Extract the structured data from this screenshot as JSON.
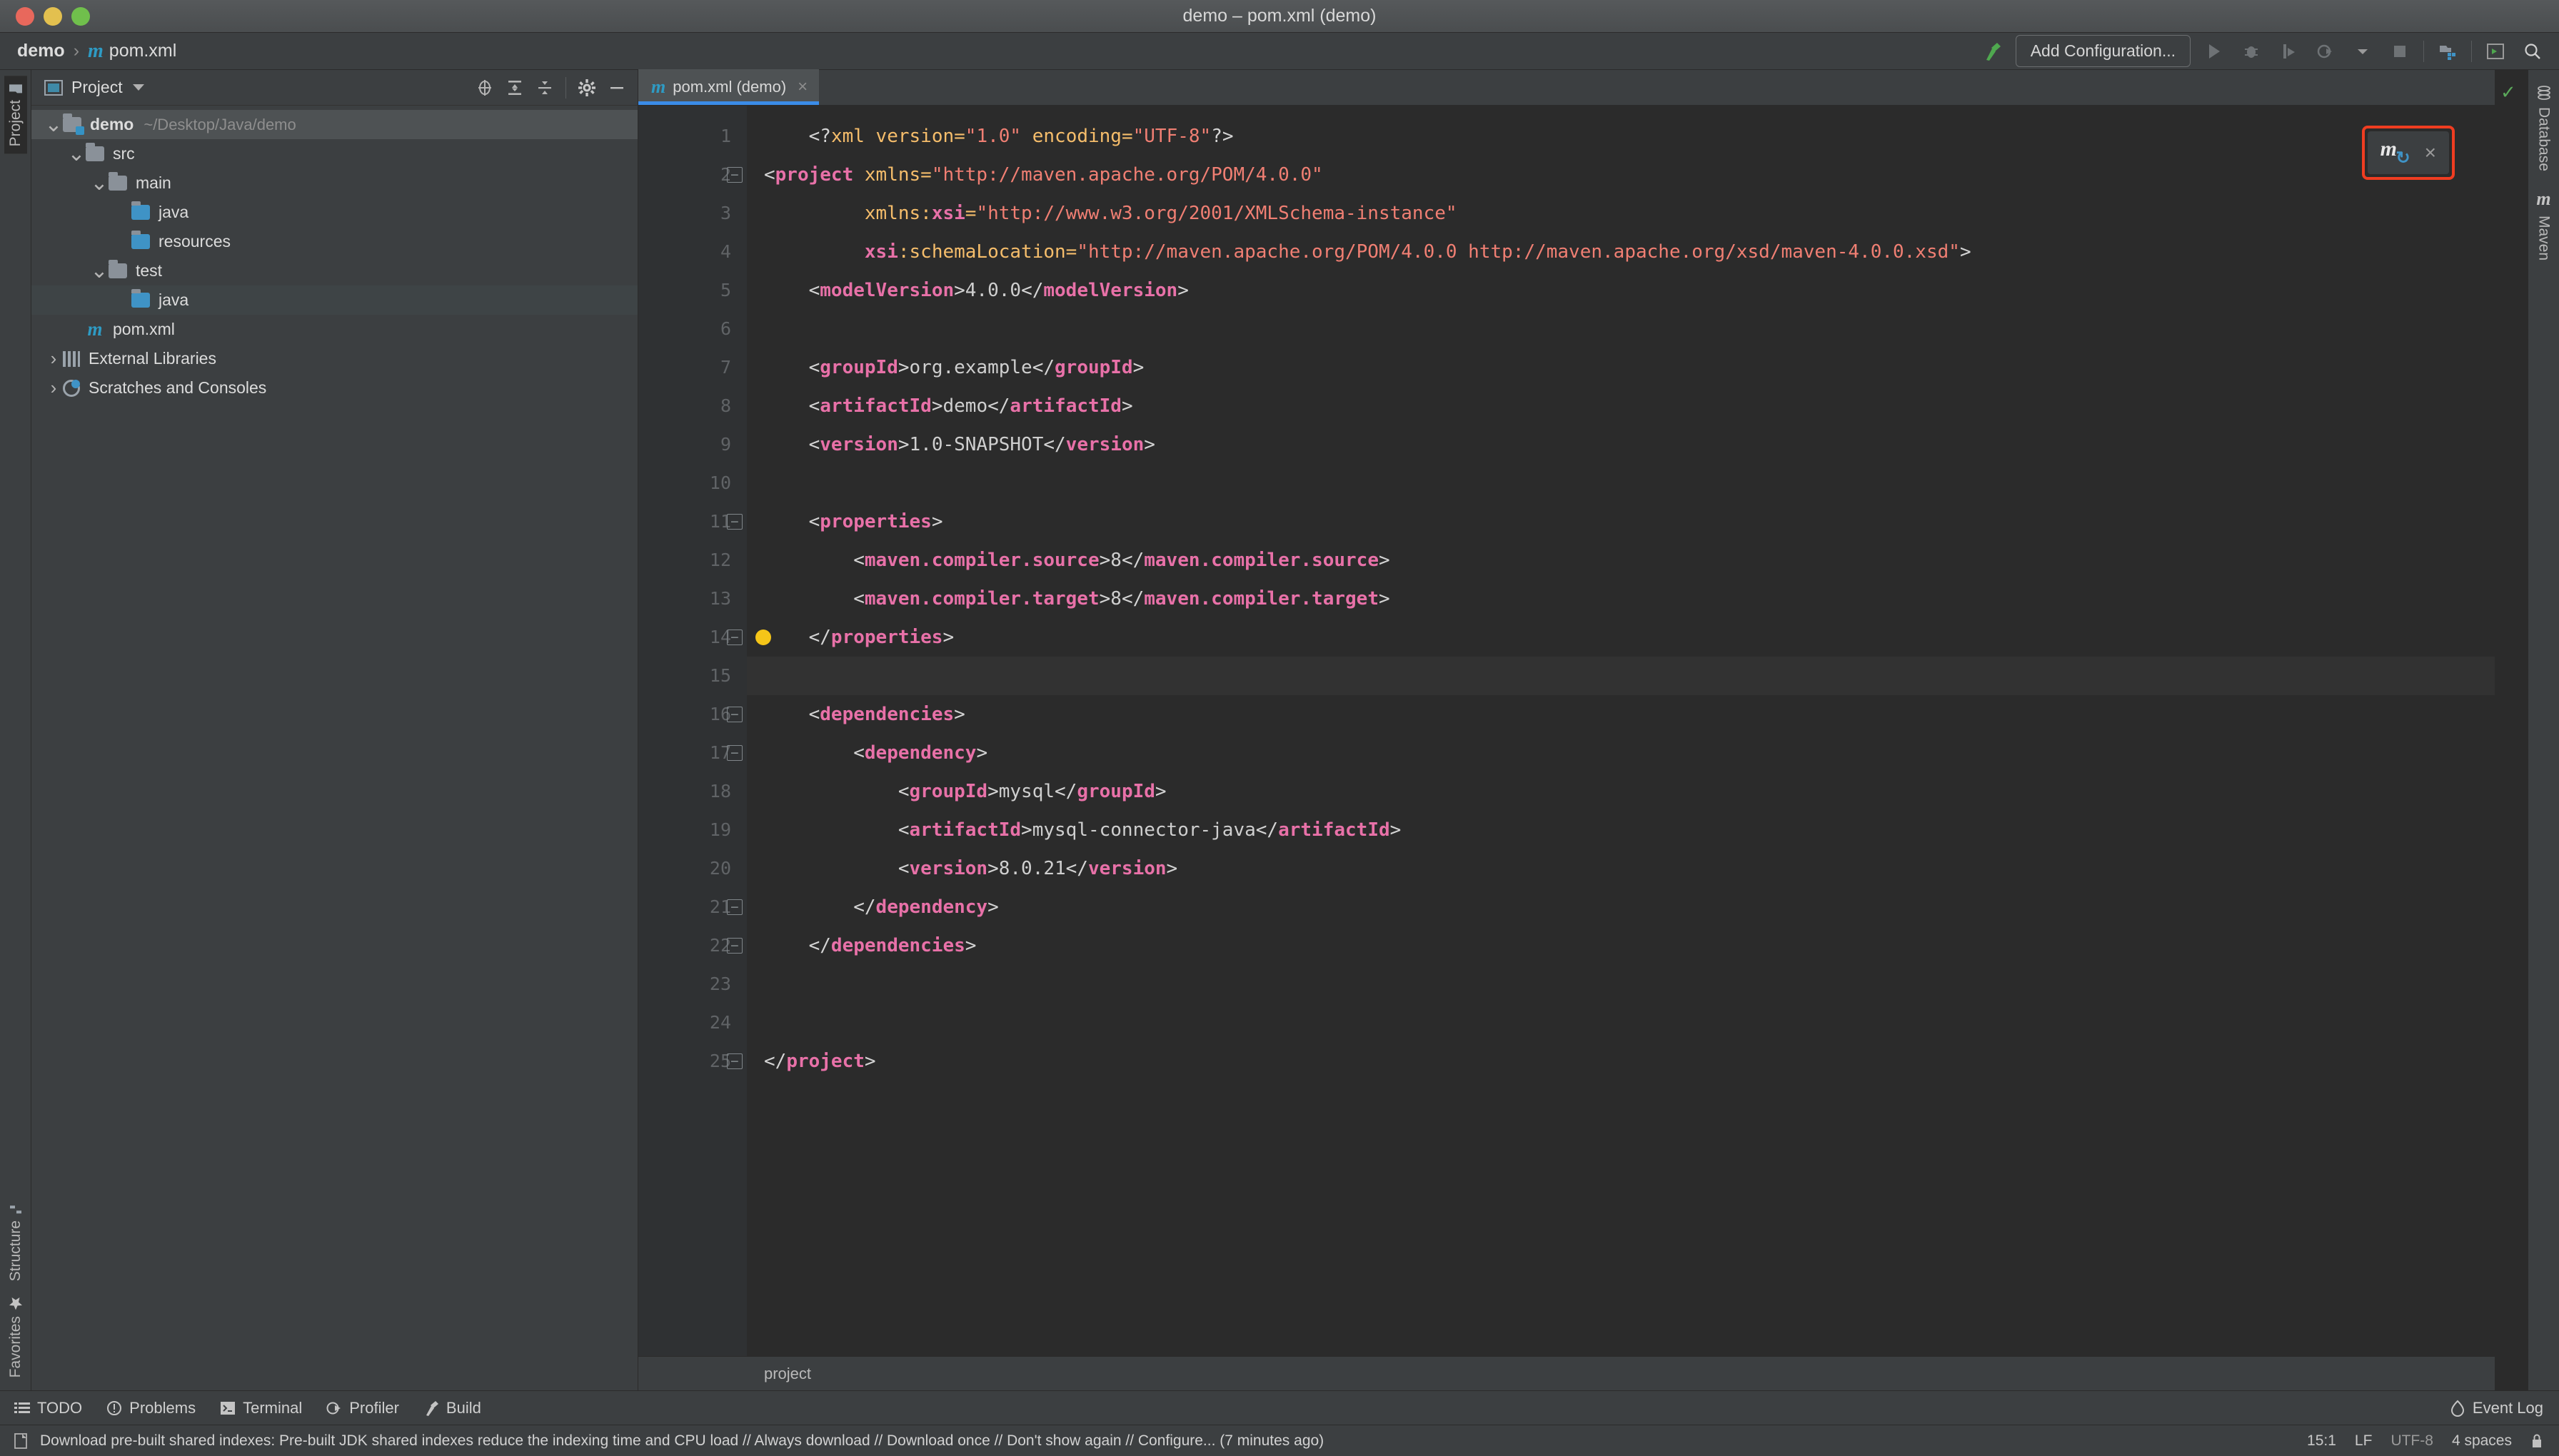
{
  "window": {
    "title": "demo – pom.xml (demo)",
    "traffic_lights": [
      "close",
      "minimize",
      "zoom"
    ]
  },
  "navbar": {
    "breadcrumb": [
      "demo",
      "pom.xml"
    ],
    "maven_glyph": "m",
    "build_icon": "hammer-icon",
    "add_configuration": "Add Configuration...",
    "icons": [
      "run-icon",
      "debug-icon",
      "run-with-coverage-icon",
      "profile-icon",
      "chevron-down-icon",
      "stop-icon",
      "project-structure-icon",
      "terminal-icon",
      "search-icon"
    ]
  },
  "left_strip": {
    "top_tab": "Project",
    "bottom_tabs": [
      "Structure",
      "Favorites"
    ]
  },
  "right_strip": {
    "tabs": [
      "Database",
      "Maven"
    ]
  },
  "project_panel": {
    "title": "Project",
    "toolbar_icons": [
      "locate-icon",
      "expand-all-icon",
      "collapse-all-icon",
      "settings-icon",
      "hide-icon"
    ],
    "tree": [
      {
        "label": "demo",
        "path": "~/Desktop/Java/demo",
        "icon": "module-folder-icon",
        "indent": 0,
        "twisty": "expanded",
        "bold": true,
        "selected": true
      },
      {
        "label": "src",
        "path": "",
        "icon": "folder-icon",
        "indent": 1,
        "twisty": "expanded",
        "bold": false,
        "selected": false
      },
      {
        "label": "main",
        "path": "",
        "icon": "folder-icon",
        "indent": 2,
        "twisty": "expanded",
        "bold": false,
        "selected": false
      },
      {
        "label": "java",
        "path": "",
        "icon": "source-folder-icon",
        "indent": 3,
        "twisty": "none",
        "bold": false,
        "selected": false
      },
      {
        "label": "resources",
        "path": "",
        "icon": "resource-folder-icon",
        "indent": 3,
        "twisty": "none",
        "bold": false,
        "selected": false
      },
      {
        "label": "test",
        "path": "",
        "icon": "folder-icon",
        "indent": 2,
        "twisty": "expanded",
        "bold": false,
        "selected": false
      },
      {
        "label": "java",
        "path": "",
        "icon": "test-source-folder-icon",
        "indent": 3,
        "twisty": "none",
        "bold": false,
        "selected": false,
        "highlight": true
      },
      {
        "label": "pom.xml",
        "path": "",
        "icon": "maven-file-icon",
        "indent": 1,
        "twisty": "none",
        "bold": false,
        "selected": false
      },
      {
        "label": "External Libraries",
        "path": "",
        "icon": "libraries-icon",
        "indent": 0,
        "twisty": "collapsed",
        "bold": false,
        "selected": false
      },
      {
        "label": "Scratches and Consoles",
        "path": "",
        "icon": "scratches-icon",
        "indent": 0,
        "twisty": "collapsed",
        "bold": false,
        "selected": false
      }
    ]
  },
  "editor": {
    "tab": {
      "label": "pom.xml (demo)",
      "icon": "maven-file-icon",
      "close": "×"
    },
    "breadcrumb": "project",
    "inspection_status": "ok-check-icon",
    "cursor_line": 15,
    "lines": [
      {
        "n": 1,
        "fold": false,
        "bulb": false,
        "tokens": [
          {
            "t": "    ",
            "c": "txt"
          },
          {
            "t": "<?",
            "c": "pun"
          },
          {
            "t": "xml",
            "c": "kw"
          },
          {
            "t": " version=",
            "c": "attr"
          },
          {
            "t": "\"1.0\"",
            "c": "str"
          },
          {
            "t": " encoding=",
            "c": "attr"
          },
          {
            "t": "\"UTF-8\"",
            "c": "str"
          },
          {
            "t": "?>",
            "c": "pun"
          }
        ]
      },
      {
        "n": 2,
        "fold": true,
        "bulb": false,
        "tokens": [
          {
            "t": "<",
            "c": "pun"
          },
          {
            "t": "project",
            "c": "tag"
          },
          {
            "t": " xmlns=",
            "c": "attr"
          },
          {
            "t": "\"http://maven.apache.org/POM/4.0.0\"",
            "c": "str"
          }
        ]
      },
      {
        "n": 3,
        "fold": false,
        "bulb": false,
        "tokens": [
          {
            "t": "         xmlns:",
            "c": "attr"
          },
          {
            "t": "xsi",
            "c": "tag"
          },
          {
            "t": "=",
            "c": "attr"
          },
          {
            "t": "\"http://www.w3.org/2001/XMLSchema-instance\"",
            "c": "str"
          }
        ]
      },
      {
        "n": 4,
        "fold": false,
        "bulb": false,
        "tokens": [
          {
            "t": "         ",
            "c": "txt"
          },
          {
            "t": "xsi",
            "c": "tag"
          },
          {
            "t": ":schemaLocation=",
            "c": "attr"
          },
          {
            "t": "\"http://maven.apache.org/POM/4.0.0 http://maven.apache.org/xsd/maven-4.0.0.xsd\"",
            "c": "str"
          },
          {
            "t": ">",
            "c": "pun"
          }
        ]
      },
      {
        "n": 5,
        "fold": false,
        "bulb": false,
        "tokens": [
          {
            "t": "    <",
            "c": "pun"
          },
          {
            "t": "modelVersion",
            "c": "tag"
          },
          {
            "t": ">",
            "c": "pun"
          },
          {
            "t": "4.0.0",
            "c": "txt"
          },
          {
            "t": "</",
            "c": "pun"
          },
          {
            "t": "modelVersion",
            "c": "tag"
          },
          {
            "t": ">",
            "c": "pun"
          }
        ]
      },
      {
        "n": 6,
        "fold": false,
        "bulb": false,
        "tokens": []
      },
      {
        "n": 7,
        "fold": false,
        "bulb": false,
        "tokens": [
          {
            "t": "    <",
            "c": "pun"
          },
          {
            "t": "groupId",
            "c": "tag"
          },
          {
            "t": ">",
            "c": "pun"
          },
          {
            "t": "org.example",
            "c": "txt"
          },
          {
            "t": "</",
            "c": "pun"
          },
          {
            "t": "groupId",
            "c": "tag"
          },
          {
            "t": ">",
            "c": "pun"
          }
        ]
      },
      {
        "n": 8,
        "fold": false,
        "bulb": false,
        "tokens": [
          {
            "t": "    <",
            "c": "pun"
          },
          {
            "t": "artifactId",
            "c": "tag"
          },
          {
            "t": ">",
            "c": "pun"
          },
          {
            "t": "demo",
            "c": "txt"
          },
          {
            "t": "</",
            "c": "pun"
          },
          {
            "t": "artifactId",
            "c": "tag"
          },
          {
            "t": ">",
            "c": "pun"
          }
        ]
      },
      {
        "n": 9,
        "fold": false,
        "bulb": false,
        "tokens": [
          {
            "t": "    <",
            "c": "pun"
          },
          {
            "t": "version",
            "c": "tag"
          },
          {
            "t": ">",
            "c": "pun"
          },
          {
            "t": "1.0-SNAPSHOT",
            "c": "txt"
          },
          {
            "t": "</",
            "c": "pun"
          },
          {
            "t": "version",
            "c": "tag"
          },
          {
            "t": ">",
            "c": "pun"
          }
        ]
      },
      {
        "n": 10,
        "fold": false,
        "bulb": false,
        "tokens": []
      },
      {
        "n": 11,
        "fold": true,
        "bulb": false,
        "tokens": [
          {
            "t": "    <",
            "c": "pun"
          },
          {
            "t": "properties",
            "c": "tag"
          },
          {
            "t": ">",
            "c": "pun"
          }
        ]
      },
      {
        "n": 12,
        "fold": false,
        "bulb": false,
        "tokens": [
          {
            "t": "        <",
            "c": "pun"
          },
          {
            "t": "maven.compiler.source",
            "c": "tag"
          },
          {
            "t": ">",
            "c": "pun"
          },
          {
            "t": "8",
            "c": "txt"
          },
          {
            "t": "</",
            "c": "pun"
          },
          {
            "t": "maven.compiler.source",
            "c": "tag"
          },
          {
            "t": ">",
            "c": "pun"
          }
        ]
      },
      {
        "n": 13,
        "fold": false,
        "bulb": false,
        "tokens": [
          {
            "t": "        <",
            "c": "pun"
          },
          {
            "t": "maven.compiler.target",
            "c": "tag"
          },
          {
            "t": ">",
            "c": "pun"
          },
          {
            "t": "8",
            "c": "txt"
          },
          {
            "t": "</",
            "c": "pun"
          },
          {
            "t": "maven.compiler.target",
            "c": "tag"
          },
          {
            "t": ">",
            "c": "pun"
          }
        ]
      },
      {
        "n": 14,
        "fold": true,
        "bulb": true,
        "tokens": [
          {
            "t": "    </",
            "c": "pun"
          },
          {
            "t": "properties",
            "c": "tag"
          },
          {
            "t": ">",
            "c": "pun"
          }
        ]
      },
      {
        "n": 15,
        "fold": false,
        "bulb": false,
        "tokens": []
      },
      {
        "n": 16,
        "fold": true,
        "bulb": false,
        "tokens": [
          {
            "t": "    <",
            "c": "pun"
          },
          {
            "t": "dependencies",
            "c": "tag"
          },
          {
            "t": ">",
            "c": "pun"
          }
        ]
      },
      {
        "n": 17,
        "fold": true,
        "bulb": false,
        "tokens": [
          {
            "t": "        <",
            "c": "pun"
          },
          {
            "t": "dependency",
            "c": "tag"
          },
          {
            "t": ">",
            "c": "pun"
          }
        ]
      },
      {
        "n": 18,
        "fold": false,
        "bulb": false,
        "tokens": [
          {
            "t": "            <",
            "c": "pun"
          },
          {
            "t": "groupId",
            "c": "tag"
          },
          {
            "t": ">",
            "c": "pun"
          },
          {
            "t": "mysql",
            "c": "txt"
          },
          {
            "t": "</",
            "c": "pun"
          },
          {
            "t": "groupId",
            "c": "tag"
          },
          {
            "t": ">",
            "c": "pun"
          }
        ]
      },
      {
        "n": 19,
        "fold": false,
        "bulb": false,
        "tokens": [
          {
            "t": "            <",
            "c": "pun"
          },
          {
            "t": "artifactId",
            "c": "tag"
          },
          {
            "t": ">",
            "c": "pun"
          },
          {
            "t": "mysql-connector-java",
            "c": "txt"
          },
          {
            "t": "</",
            "c": "pun"
          },
          {
            "t": "artifactId",
            "c": "tag"
          },
          {
            "t": ">",
            "c": "pun"
          }
        ]
      },
      {
        "n": 20,
        "fold": false,
        "bulb": false,
        "tokens": [
          {
            "t": "            <",
            "c": "pun"
          },
          {
            "t": "version",
            "c": "tag"
          },
          {
            "t": ">",
            "c": "pun"
          },
          {
            "t": "8.0.21",
            "c": "txt"
          },
          {
            "t": "</",
            "c": "pun"
          },
          {
            "t": "version",
            "c": "tag"
          },
          {
            "t": ">",
            "c": "pun"
          }
        ]
      },
      {
        "n": 21,
        "fold": true,
        "bulb": false,
        "tokens": [
          {
            "t": "        </",
            "c": "pun"
          },
          {
            "t": "dependency",
            "c": "tag"
          },
          {
            "t": ">",
            "c": "pun"
          }
        ]
      },
      {
        "n": 22,
        "fold": true,
        "bulb": false,
        "tokens": [
          {
            "t": "    </",
            "c": "pun"
          },
          {
            "t": "dependencies",
            "c": "tag"
          },
          {
            "t": ">",
            "c": "pun"
          }
        ]
      },
      {
        "n": 23,
        "fold": false,
        "bulb": false,
        "tokens": []
      },
      {
        "n": 24,
        "fold": false,
        "bulb": false,
        "tokens": []
      },
      {
        "n": 25,
        "fold": true,
        "bulb": false,
        "tokens": [
          {
            "t": "</",
            "c": "pun"
          },
          {
            "t": "project",
            "c": "tag"
          },
          {
            "t": ">",
            "c": "pun"
          }
        ]
      }
    ]
  },
  "maven_popup": {
    "glyph": "m",
    "sync_icon": "reload-icon",
    "close": "×",
    "highlight_color": "#f03d21"
  },
  "bottom_tools": [
    {
      "label": "TODO",
      "icon": "todo-icon"
    },
    {
      "label": "Problems",
      "icon": "problems-icon"
    },
    {
      "label": "Terminal",
      "icon": "terminal-icon"
    },
    {
      "label": "Profiler",
      "icon": "profiler-icon"
    },
    {
      "label": "Build",
      "icon": "build-icon"
    }
  ],
  "event_log": {
    "label": "Event Log",
    "icon": "balloon-icon"
  },
  "statusbar": {
    "message": "Download pre-built shared indexes: Pre-built JDK shared indexes reduce the indexing time and CPU load // Always download // Download once // Don't show again // Configure... (7 minutes ago)",
    "caret_position": "15:1",
    "line_separator": "LF",
    "encoding": "UTF-8",
    "indent": "4 spaces",
    "lock_icon": "lock-icon"
  },
  "colors": {
    "accent_blue": "#3b8ce8",
    "tag_pink": "#e871a8",
    "attr_orange": "#f5bd6b",
    "string_salmon": "#f07f73",
    "maven_blue": "#2e9bc4",
    "highlight_red": "#f03d21"
  }
}
